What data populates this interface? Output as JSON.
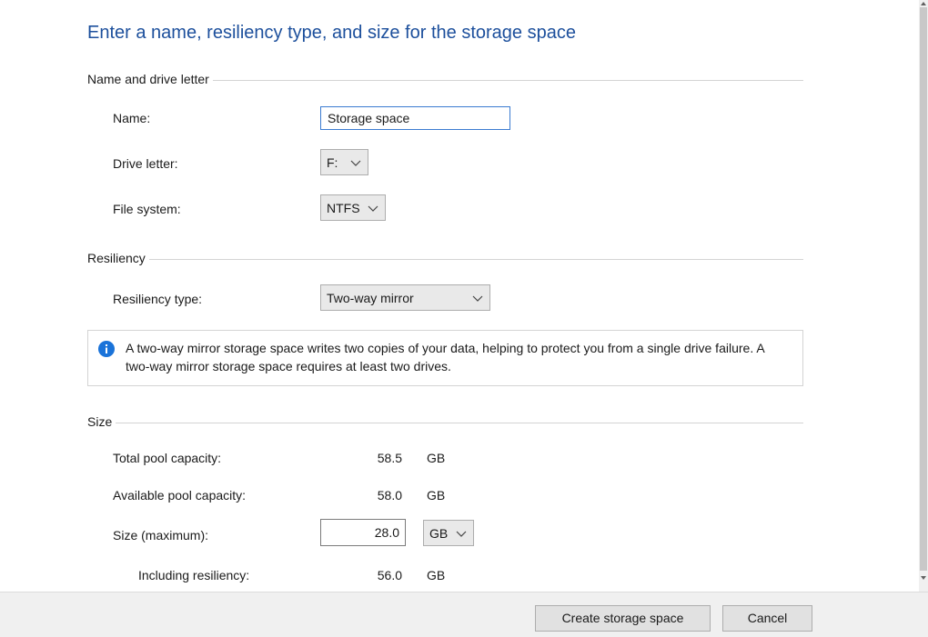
{
  "page_title": "Enter a name, resiliency type, and size for the storage space",
  "name_section": {
    "title": "Name and drive letter",
    "name_label": "Name:",
    "name_value": "Storage space",
    "drive_letter_label": "Drive letter:",
    "drive_letter_value": "F:",
    "file_system_label": "File system:",
    "file_system_value": "NTFS"
  },
  "resiliency_section": {
    "title": "Resiliency",
    "type_label": "Resiliency type:",
    "type_value": "Two-way mirror",
    "info_text": "A two-way mirror storage space writes two copies of your data, helping to protect you from a single drive failure. A two-way mirror storage space requires at least two drives."
  },
  "size_section": {
    "title": "Size",
    "total_label": "Total pool capacity:",
    "total_value": "58.5",
    "total_unit": "GB",
    "available_label": "Available pool capacity:",
    "available_value": "58.0",
    "available_unit": "GB",
    "size_label": "Size (maximum):",
    "size_value": "28.0",
    "size_unit": "GB",
    "including_label": "Including resiliency:",
    "including_value": "56.0",
    "including_unit": "GB"
  },
  "footer": {
    "create_label": "Create storage space",
    "cancel_label": "Cancel"
  },
  "icons": {
    "info": "info-icon",
    "dropdown": "chevron-down-icon"
  },
  "colors": {
    "heading": "#1c4f9c",
    "info_icon": "#1a73d9",
    "focus_border": "#3b7bd1"
  }
}
